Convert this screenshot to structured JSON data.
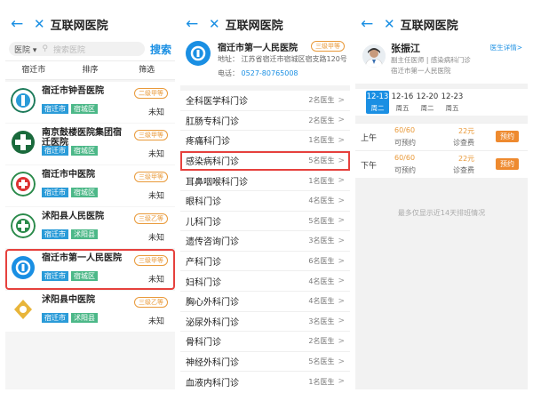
{
  "panel1": {
    "title": "互联网医院",
    "search_scope": "医院",
    "search_placeholder": "搜索医院",
    "search_button": "搜索",
    "filters": [
      "宿迁市",
      "排序",
      "筛选"
    ],
    "hospitals": [
      {
        "name": "宿迁市钟吾医院",
        "tags": [
          "宿迁市",
          "宿城区"
        ],
        "grade": "二级甲等",
        "status": "未知"
      },
      {
        "name": "南京鼓楼医院集团宿迁医院",
        "tags": [
          "宿迁市",
          "宿城区"
        ],
        "grade": "三级甲等",
        "status": "未知"
      },
      {
        "name": "宿迁市中医院",
        "tags": [
          "宿迁市",
          "宿城区"
        ],
        "grade": "三级甲等",
        "status": "未知"
      },
      {
        "name": "沭阳县人民医院",
        "tags": [
          "宿迁市",
          "沭阳县"
        ],
        "grade": "三级乙等",
        "status": "未知"
      },
      {
        "name": "宿迁市第一人民医院",
        "tags": [
          "宿迁市",
          "宿城区"
        ],
        "grade": "三级甲等",
        "status": "未知"
      },
      {
        "name": "沭阳县中医院",
        "tags": [
          "宿迁市",
          "沭阳县"
        ],
        "grade": "三级乙等",
        "status": "未知"
      }
    ]
  },
  "panel2": {
    "title": "互联网医院",
    "hospital": {
      "name": "宿迁市第一人民医院",
      "grade": "三级甲等",
      "address": "地址：  江苏省宿迁市宿城区宿支路120号",
      "tel_label": "电话：",
      "tel": "0527-80765008"
    },
    "departments": [
      {
        "name": "全科医学科门诊",
        "count": "2名医生"
      },
      {
        "name": "肛肠专科门诊",
        "count": "2名医生"
      },
      {
        "name": "疼痛科门诊",
        "count": "1名医生"
      },
      {
        "name": "感染病科门诊",
        "count": "5名医生"
      },
      {
        "name": "耳鼻咽喉科门诊",
        "count": "1名医生"
      },
      {
        "name": "眼科门诊",
        "count": "4名医生"
      },
      {
        "name": "儿科门诊",
        "count": "5名医生"
      },
      {
        "name": "遗传咨询门诊",
        "count": "3名医生"
      },
      {
        "name": "产科门诊",
        "count": "6名医生"
      },
      {
        "name": "妇科门诊",
        "count": "4名医生"
      },
      {
        "name": "胸心外科门诊",
        "count": "4名医生"
      },
      {
        "name": "泌尿外科门诊",
        "count": "3名医生"
      },
      {
        "name": "骨科门诊",
        "count": "2名医生"
      },
      {
        "name": "神经外科门诊",
        "count": "5名医生"
      },
      {
        "name": "血液内科门诊",
        "count": "1名医生"
      }
    ]
  },
  "panel3": {
    "title": "互联网医院",
    "doctor": {
      "name": "张振江",
      "title": "副主任医师 | 感染病科门诊",
      "hospital": "宿迁市第一人民医院",
      "detail_link": "医生详情>"
    },
    "dates": [
      {
        "date": "12-13",
        "weekday": "周二"
      },
      {
        "date": "12-16",
        "weekday": "周五"
      },
      {
        "date": "12-20",
        "weekday": "周二"
      },
      {
        "date": "12-23",
        "weekday": "周五"
      }
    ],
    "slots": [
      {
        "period": "上午",
        "quota": "60/60",
        "quota_label": "可预约",
        "fee": "22元",
        "fee_label": "诊查费",
        "button": "预约"
      },
      {
        "period": "下午",
        "quota": "60/60",
        "quota_label": "可预约",
        "fee": "22元",
        "fee_label": "诊查费",
        "button": "预约"
      }
    ],
    "note": "最多仅显示近14天排班情况"
  },
  "colors": {
    "accent": "#1a8fe3",
    "highlight": "#e6413d",
    "orange": "#ee8a2f"
  }
}
